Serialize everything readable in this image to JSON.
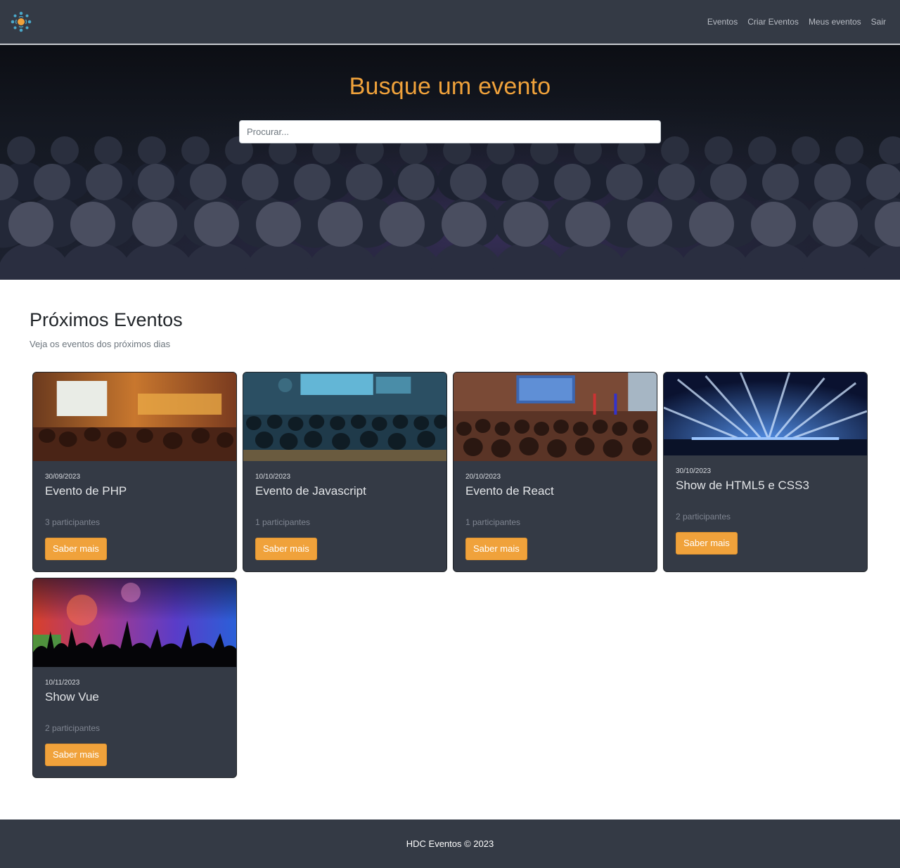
{
  "navbar": {
    "logo_icon": "people-network-logo-icon",
    "links": [
      "Eventos",
      "Criar Eventos",
      "Meus eventos",
      "Sair"
    ]
  },
  "hero": {
    "title": "Busque um evento",
    "search_placeholder": "Procurar..."
  },
  "events_section": {
    "title": "Próximos Eventos",
    "subtitle": "Veja os eventos dos próximos dias",
    "cards": [
      {
        "date": "30/09/2023",
        "title": "Evento de PHP",
        "participants": "3 participantes",
        "button": "Saber mais",
        "image": "conference-hall-photo"
      },
      {
        "date": "10/10/2023",
        "title": "Evento de Javascript",
        "participants": "1 participantes",
        "button": "Saber mais",
        "image": "audience-screens-photo"
      },
      {
        "date": "20/10/2023",
        "title": "Evento de React",
        "participants": "1 participantes",
        "button": "Saber mais",
        "image": "auditorium-stage-photo"
      },
      {
        "date": "30/10/2023",
        "title": "Show de HTML5 e CSS3",
        "participants": "2 participantes",
        "button": "Saber mais",
        "image": "concert-stage-lights-photo"
      },
      {
        "date": "10/11/2023",
        "title": "Show Vue",
        "participants": "2 participantes",
        "button": "Saber mais",
        "image": "crowd-silhouette-photo"
      }
    ]
  },
  "footer": {
    "text": "HDC Eventos © 2023"
  },
  "colors": {
    "navbar_bg": "#343a45",
    "accent": "#f0a23b",
    "card_bg": "#343a45"
  }
}
